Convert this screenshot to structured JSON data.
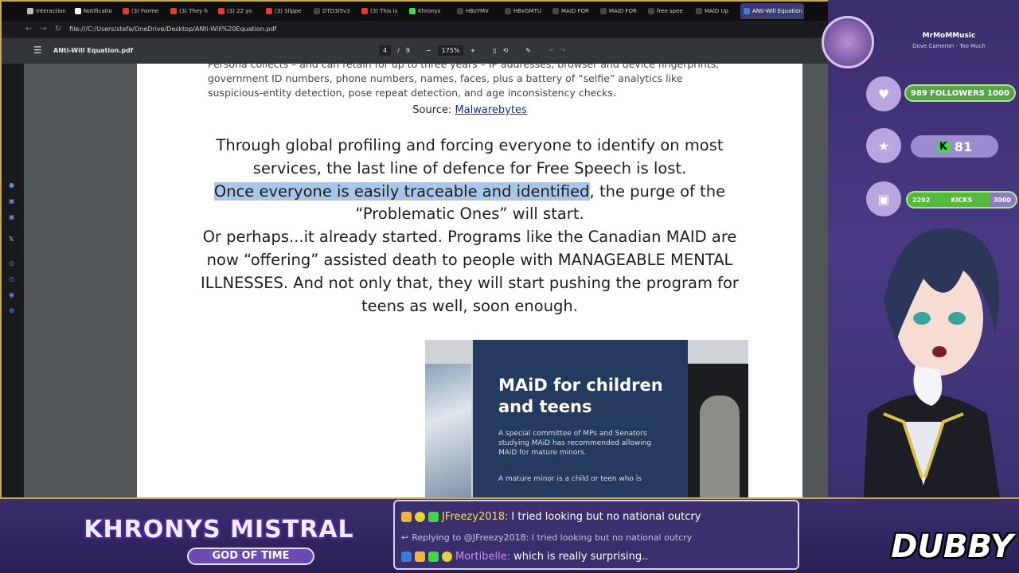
{
  "browser": {
    "tabs": [
      {
        "label": "Interaction",
        "color": "#bbbbbb"
      },
      {
        "label": "Notificatio",
        "color": "#ffffff"
      },
      {
        "label": "(3) Forme",
        "color": "#e53935"
      },
      {
        "label": "(3) They h",
        "color": "#e53935"
      },
      {
        "label": "(3) 22 yo",
        "color": "#e53935"
      },
      {
        "label": "(3) Slippe",
        "color": "#e53935"
      },
      {
        "label": "DTD3I5v3",
        "color": "#444444"
      },
      {
        "label": "(3) This is",
        "color": "#e53935"
      },
      {
        "label": "Khronys",
        "color": "#42d84a"
      },
      {
        "label": "HBzYMV",
        "color": "#444444"
      },
      {
        "label": "HBxGMTU",
        "color": "#444444"
      },
      {
        "label": "MAID FOR",
        "color": "#444444"
      },
      {
        "label": "MAID FOR",
        "color": "#444444"
      },
      {
        "label": "free spee",
        "color": "#444444"
      },
      {
        "label": "MAiD Up",
        "color": "#444444"
      },
      {
        "label": "ANti-Will Equation",
        "color": "#4a7bd8",
        "active": true
      }
    ],
    "url": "file:///C:/Users/stefa/OneDrive/Desktop/ANti-Will%20Equation.pdf"
  },
  "pdf": {
    "title": "ANti-Will Equation.pdf",
    "page_current": "4",
    "page_sep": "/",
    "page_total": "9",
    "zoom": "175%",
    "zoom_out": "−",
    "zoom_in": "+"
  },
  "document": {
    "persona_text": "Persona collects – and can retain for up to three years – IP addresses, browser and device fingerprints, government ID numbers, phone numbers, names, faces, plus a battery of “selfie” analytics like suspicious-entity detection, pose repeat detection, and age inconsistency checks.",
    "source_prefix": "Source: ",
    "source_link": "Malwarebytes",
    "line1": "Through global profiling and forcing everyone to identify on most services, the last line of defence for Free Speech is lost.",
    "highlight": "Once everyone is easily traceable and identified",
    "line2_rest": ", the purge of the “Problematic Ones” will start.",
    "line3": "Or perhaps...it already started. Programs like the Canadian MAID are now “offering” assisted death to people with MANAGEABLE MENTAL ILLNESSES. And not only that, they will start pushing the program for teens as well, soon enough.",
    "poster_title": "MAiD for children and teens",
    "poster_sub": "A special committee of MPs and Senators studying MAiD has recommended allowing MAiD for mature minors.",
    "poster_sub2": "A mature minor is a child or teen who is"
  },
  "overlay": {
    "music_artist": "MrMoMMusic",
    "music_track": "Dove Cameron - Too Much",
    "followers_current": "989",
    "followers_label": "FOLLOWERS",
    "followers_goal": "1000",
    "kick_count": "81",
    "kicks_current": "2292",
    "kicks_label": "KICKS",
    "kicks_goal": "3000",
    "logo_title": "KHRONYS MISTRAL",
    "logo_sub": "GOD OF TIME",
    "brand": "DUBBY"
  },
  "chat": {
    "msg1_user": "JFreezy2018:",
    "msg1_text": "I tried looking but no national outcry",
    "reply_text": "Replying to @JFreezy2018: I tried looking but no national outcry",
    "msg2_user": "Mortibelle:",
    "msg2_text": "which is really surprising.."
  },
  "colors": {
    "accent_gold": "#c9a94a",
    "highlight": "#a8c7e8",
    "goal_green": "#5aa14a",
    "panel_purple": "#4a3a86"
  }
}
